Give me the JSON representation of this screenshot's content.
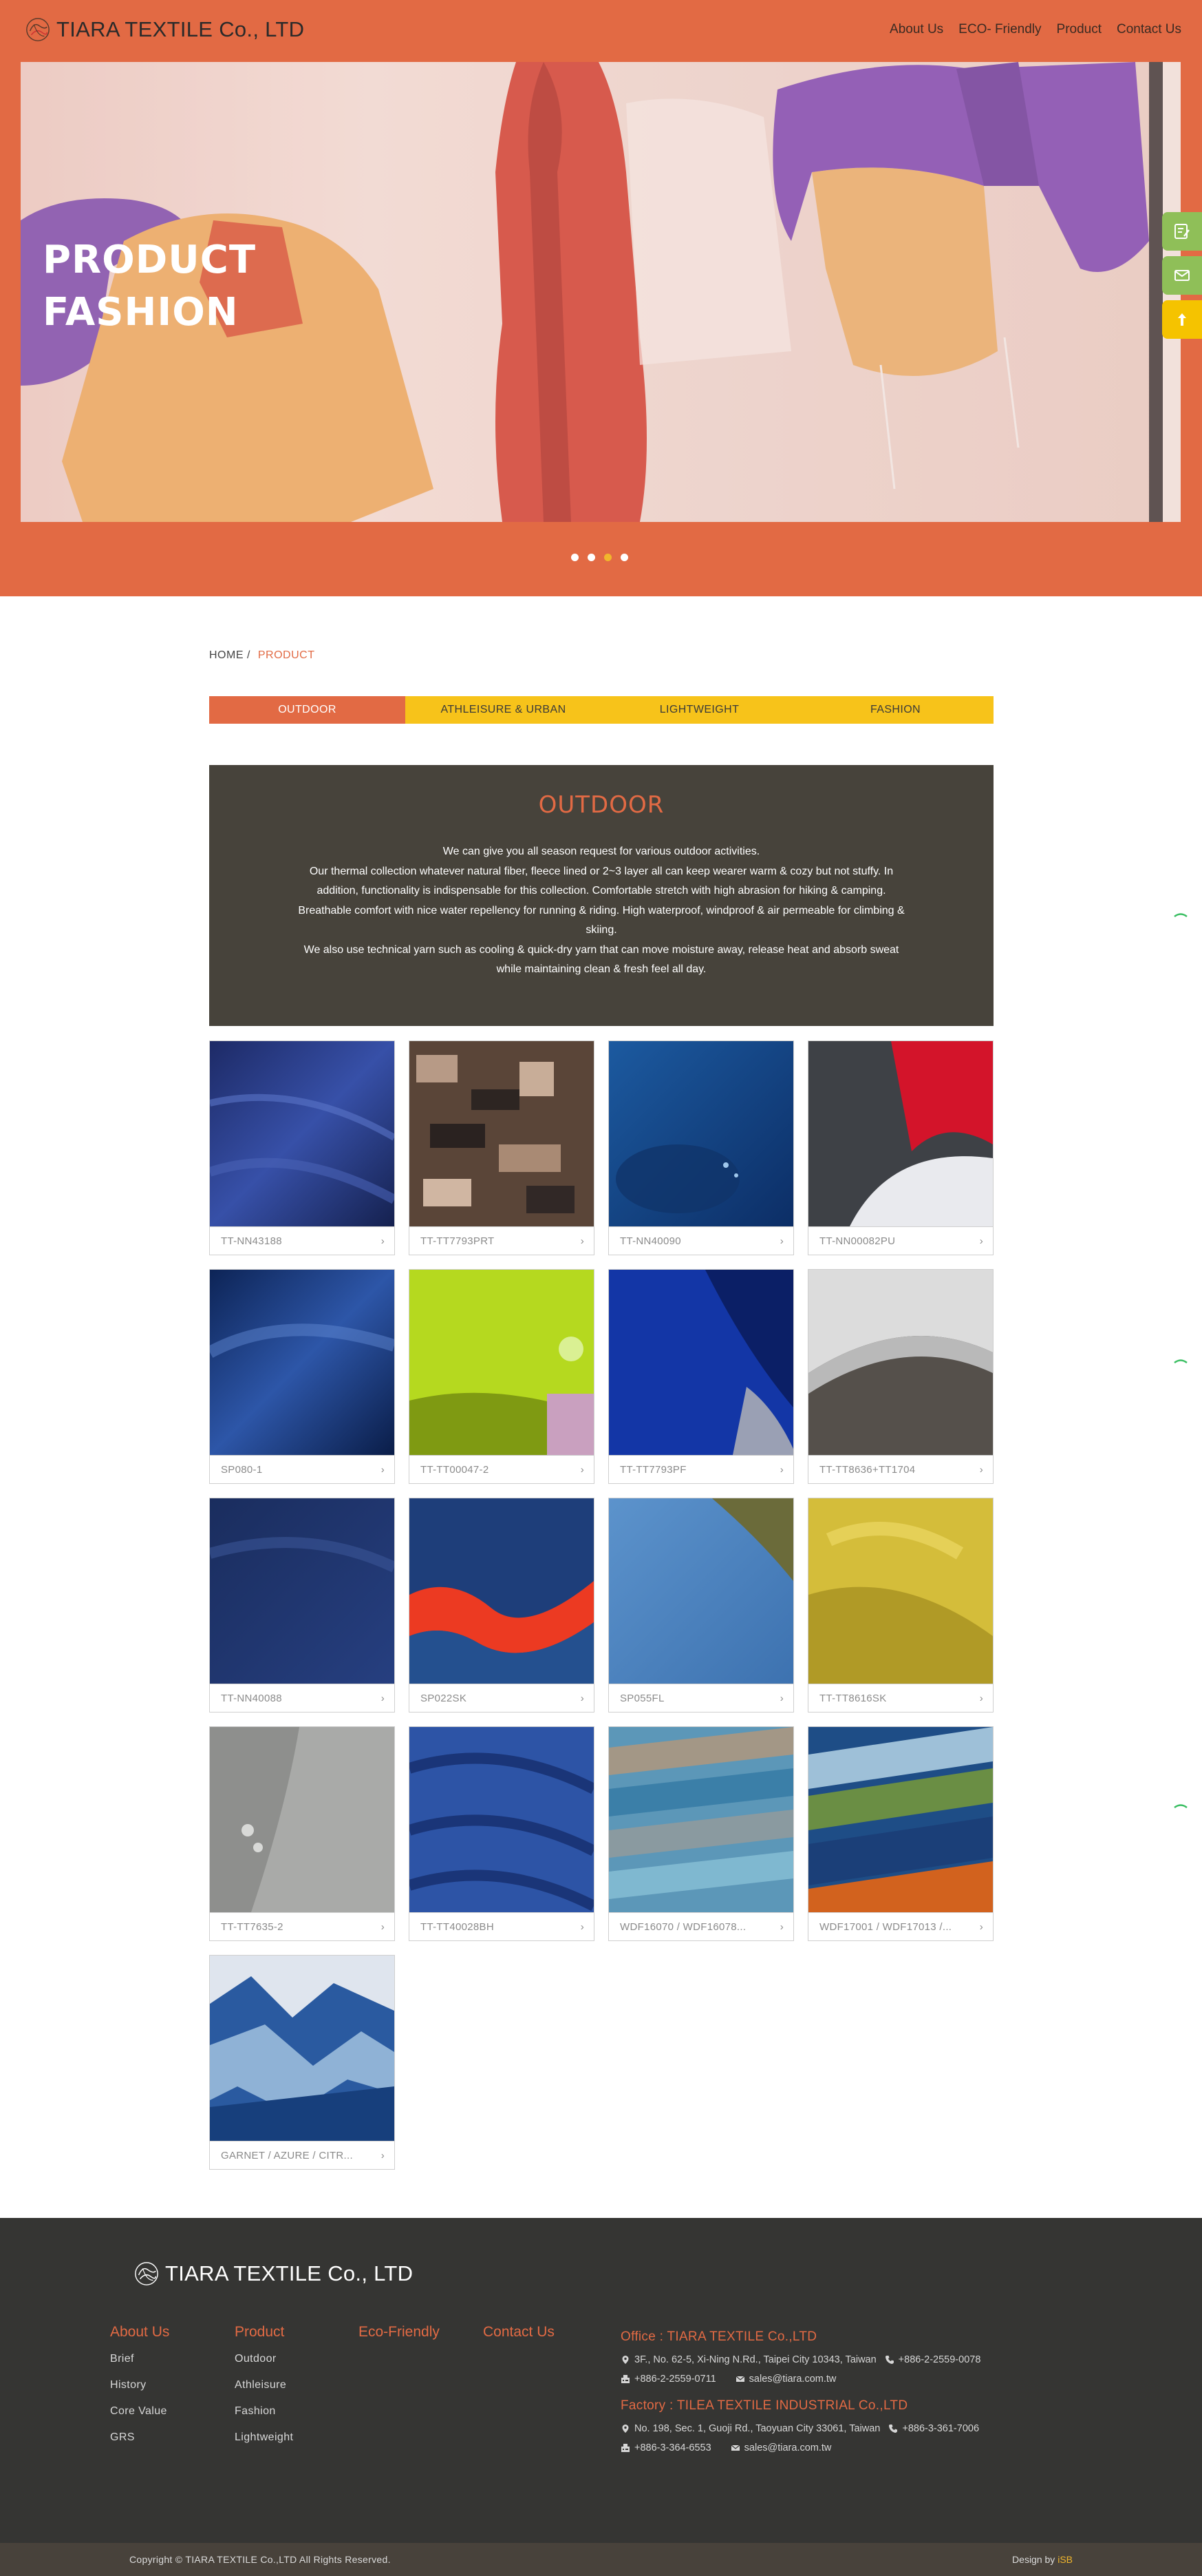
{
  "brand": {
    "name": "TIARA TEXTILE Co., LTD"
  },
  "nav": [
    {
      "label": "About Us"
    },
    {
      "label": "ECO- Friendly"
    },
    {
      "label": "Product"
    },
    {
      "label": "Contact Us"
    }
  ],
  "hero": {
    "line1": "PRODUCT",
    "line2": "FASHION",
    "slides": 4,
    "active_slide": 3
  },
  "breadcrumb": {
    "home": "HOME",
    "sep": "/",
    "current": "PRODUCT"
  },
  "tabs": [
    {
      "label": "OUTDOOR",
      "active": true
    },
    {
      "label": "ATHLEISURE & URBAN",
      "active": false
    },
    {
      "label": "LIGHTWEIGHT",
      "active": false
    },
    {
      "label": "FASHION",
      "active": false
    }
  ],
  "intro": {
    "title": "OUTDOOR",
    "p1": "We can give you all season request for various outdoor activities.",
    "p2": "Our thermal collection whatever natural fiber, fleece lined or 2~3 layer all can keep wearer warm & cozy but not stuffy. In addition, functionality is indispensable for this collection. Comfortable stretch with high abrasion for hiking & camping. Breathable comfort with nice water repellency for running & riding. High waterproof, windproof & air permeable for climbing & skiing.",
    "p3": "We also use technical yarn such as cooling & quick-dry yarn that can move moisture away, release heat and absorb sweat while maintaining clean & fresh feel all day."
  },
  "products": [
    {
      "code": "TT-NN43188"
    },
    {
      "code": "TT-TT7793PRT"
    },
    {
      "code": "TT-NN40090"
    },
    {
      "code": "TT-NN00082PU"
    },
    {
      "code": "SP080-1"
    },
    {
      "code": "TT-TT00047-2"
    },
    {
      "code": "TT-TT7793PF"
    },
    {
      "code": "TT-TT8636+TT1704"
    },
    {
      "code": "TT-NN40088"
    },
    {
      "code": "SP022SK"
    },
    {
      "code": "SP055FL"
    },
    {
      "code": "TT-TT8616SK"
    },
    {
      "code": "TT-TT7635-2"
    },
    {
      "code": "TT-TT40028BH"
    },
    {
      "code": "WDF16070 / WDF16078..."
    },
    {
      "code": "WDF17001 / WDF17013 /..."
    },
    {
      "code": "GARNET / AZURE / CITR..."
    }
  ],
  "footer": {
    "col_about": {
      "title": "About Us",
      "items": [
        "Brief",
        "History",
        "Core Value",
        "GRS"
      ]
    },
    "col_product": {
      "title": "Product",
      "items": [
        "Outdoor",
        "Athleisure",
        "Fashion",
        "Lightweight"
      ]
    },
    "col_eco": {
      "title": "Eco-Friendly"
    },
    "col_contact": {
      "title": "Contact Us"
    },
    "office": {
      "title": "Office : TIARA TEXTILE Co.,LTD",
      "address": "3F., No. 62-5, Xi-Ning N.Rd., Taipei City 10343, Taiwan",
      "phone": "+886-2-2559-0078",
      "fax": "+886-2-2559-0711",
      "email": "sales@tiara.com.tw"
    },
    "factory": {
      "title": "Factory : TILEA TEXTILE INDUSTRIAL Co.,LTD",
      "address": "No. 198, Sec. 1, Guoji Rd., Taoyuan City 33061, Taiwan",
      "phone": "+886-3-361-7006",
      "fax": "+886-3-364-6553",
      "email": "sales@tiara.com.tw"
    },
    "copyright": "Copyright © TIARA TEXTILE Co.,LTD All Rights Reserved.",
    "design_by": "Design by",
    "designer": "iSB"
  },
  "colors": {
    "brand": "#e26a44",
    "accent": "#f7c31a",
    "dark": "#47433b",
    "footer": "#353533"
  }
}
